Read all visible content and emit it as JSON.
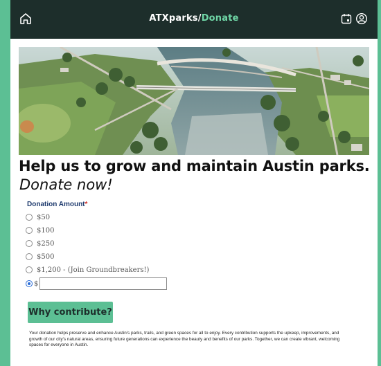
{
  "header": {
    "brand": "ATXparks",
    "separator": "/",
    "section": "Donate",
    "icons": [
      "home-icon",
      "calendar-icon",
      "user-icon"
    ],
    "bg_color": "#1d2e2b",
    "accent_color": "#6fd6a6"
  },
  "hero": {
    "image": "aerial-river-park-photo"
  },
  "page": {
    "headline": "Help us to grow and maintain Austin parks.",
    "subhead": "Donate now!"
  },
  "form": {
    "amount_label": "Donation Amount",
    "required_mark": "*",
    "options": [
      "$50",
      "$100",
      "$250",
      "$500",
      "$1,200 - (Join Groundbreakers!)"
    ],
    "custom_prefix": "$",
    "custom_value": "",
    "selected": "custom"
  },
  "why_button": {
    "label": "Why contribute?",
    "color": "#5cbf94"
  },
  "blurb": "Your donation helps preserve and enhance Austin's parks, trails, and green spaces for all to enjoy. Every contribution supports the upkeep, improvements, and growth of our city's natural areas, ensuring future generations can experience the beauty and benefits of our parks. Together, we can create vibrant, welcoming spaces for everyone in Austin."
}
